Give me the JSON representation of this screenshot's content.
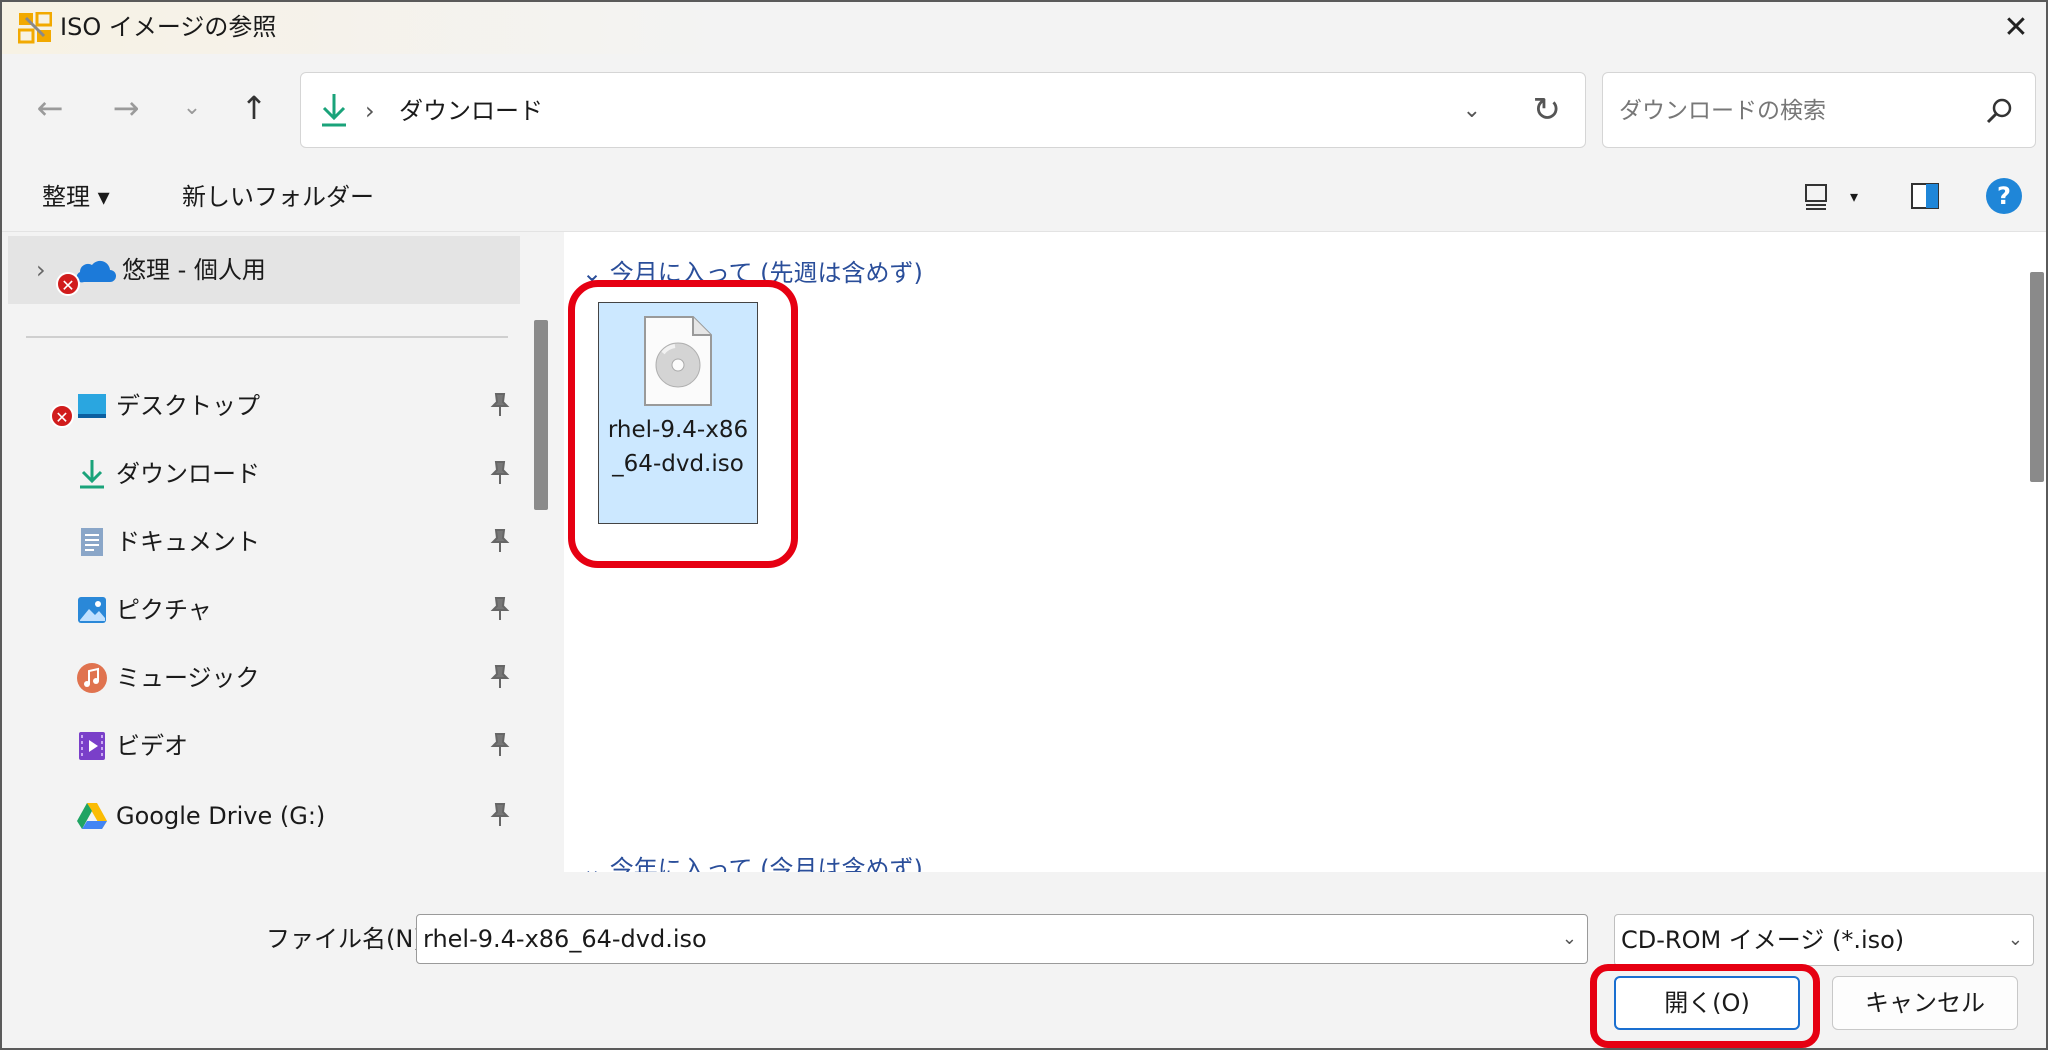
{
  "window": {
    "title": "ISO イメージの参照",
    "close_glyph": "✕"
  },
  "navbar": {
    "back_glyph": "←",
    "forward_glyph": "→",
    "recent_glyph": "⌄",
    "up_glyph": "↑",
    "address_separator": "›",
    "address_text": "ダウンロード",
    "dropdown_glyph": "⌄",
    "refresh_glyph": "↻",
    "search_placeholder": "ダウンロードの検索"
  },
  "toolbar": {
    "organize_label": "整理 ▾",
    "new_folder_label": "新しいフォルダー",
    "view_dd_glyph": "▾",
    "help_glyph": "?"
  },
  "sidebar": {
    "onedrive": {
      "chevron": "›",
      "label": "悠理 - 個人用",
      "error_glyph": "✕"
    },
    "items": [
      {
        "label": "デスクトップ",
        "icon": "desktop-icon"
      },
      {
        "label": "ダウンロード",
        "icon": "download-icon"
      },
      {
        "label": "ドキュメント",
        "icon": "documents-icon"
      },
      {
        "label": "ピクチャ",
        "icon": "pictures-icon"
      },
      {
        "label": "ミュージック",
        "icon": "music-icon"
      },
      {
        "label": "ビデオ",
        "icon": "videos-icon"
      },
      {
        "label": "Google Drive (G:)",
        "icon": "google-drive-icon"
      }
    ],
    "error_glyph": "✕"
  },
  "content": {
    "groups": [
      {
        "label": "⌄  今月に入って (先週は含めず)"
      },
      {
        "label": "⌄  今年に入って (今月は含めず)"
      }
    ],
    "file": {
      "name": "rhel-9.4-x86_64-dvd.iso",
      "icon": "disc-image-icon"
    }
  },
  "bottom": {
    "filename_label": "ファイル名(N):",
    "filename_value": "rhel-9.4-x86_64-dvd.iso",
    "dd_glyph": "⌄",
    "filetype_value": "CD-ROM イメージ (*.iso)",
    "open_label": "開く(O)",
    "cancel_label": "キャンセル"
  },
  "colors": {
    "highlight": "#e60012",
    "selection": "#cce8ff",
    "accent": "#1a6fd0"
  }
}
